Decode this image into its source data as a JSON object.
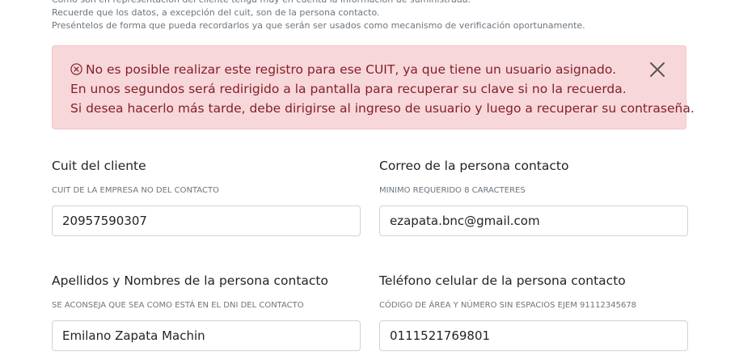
{
  "intro": {
    "line1": "Como son en representación del cliente tenga muy en cuenta la información ue suministrada.",
    "line2": "Recuerde que los datos, a excepción del cuit, son de la persona contacto.",
    "line3": "Preséntelos de forma que pueda recordarlos ya que serán ser usados como mecanismo de verificación oportunamente."
  },
  "alert": {
    "line1": "No es posible realizar este registro para ese CUIT, ya que tiene un usuario asignado.",
    "line2": "En unos segundos será redirigido a la pantalla para recuperar su clave si no la recuerda.",
    "line3": "Si desea hacerlo más tarde, debe dirigirse al ingreso de usuario y luego a recuperar su contraseña.",
    "icon": "error-circle-icon",
    "close_icon": "close-icon",
    "color": "#842029",
    "background": "#f8d7da"
  },
  "form": {
    "cuit": {
      "label": "Cuit del cliente",
      "hint": "CUIT DE LA EMPRESA NO DEL CONTACTO",
      "value": "20957590307"
    },
    "email": {
      "label": "Correo de la persona contacto",
      "hint": "MINIMO REQUERIDO 8 CARACTERES",
      "value": "ezapata.bnc@gmail.com"
    },
    "name": {
      "label": "Apellidos y Nombres de la persona contacto",
      "hint": "SE ACONSEJA QUE SEA COMO ESTÁ EN EL DNI DEL CONTACTO",
      "value": "Emilano Zapata Machin"
    },
    "phone": {
      "label": "Teléfono celular de la persona contacto",
      "hint": "CÓDIGO DE ÁREA Y NÚMERO SIN ESPACIOS EJEM 91112345678",
      "value": "0111521769801"
    }
  }
}
